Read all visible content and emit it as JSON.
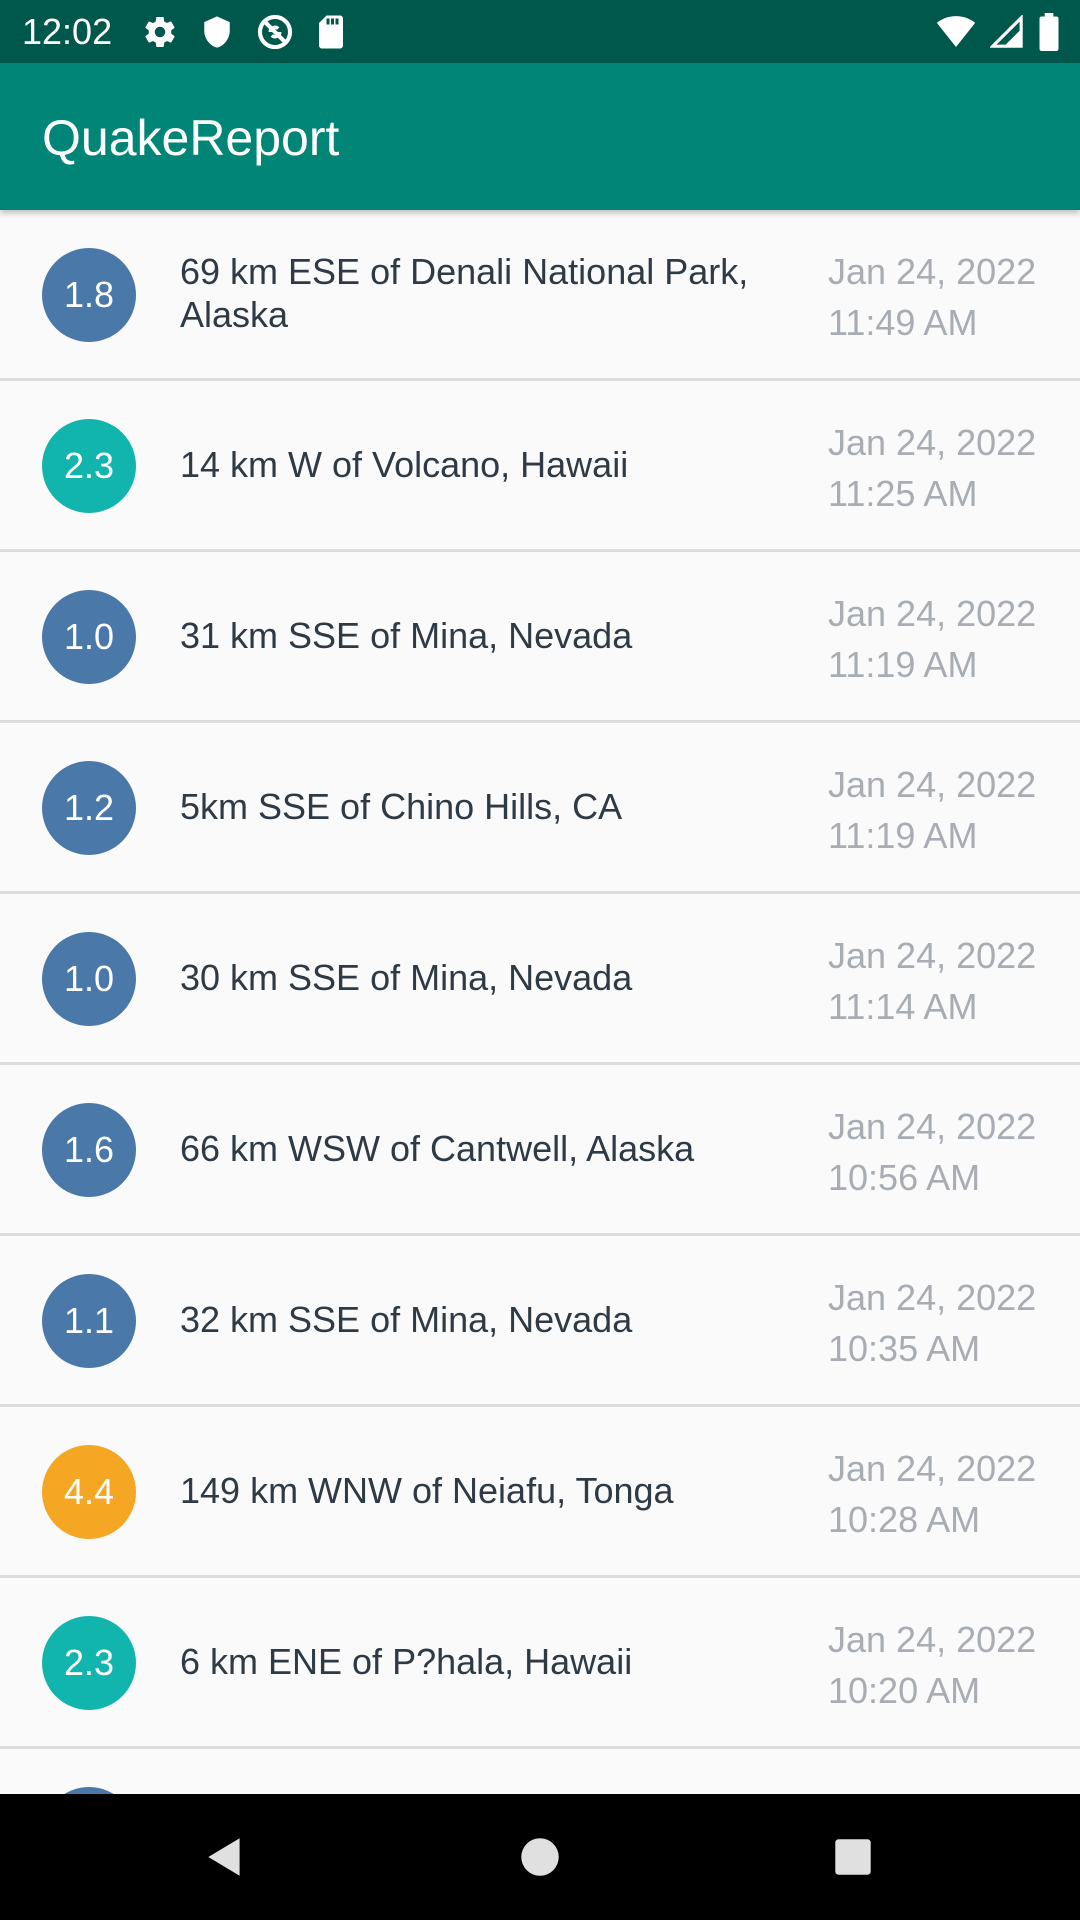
{
  "status_bar": {
    "time": "12:02",
    "left_icons": [
      "settings-icon",
      "shield-icon",
      "no-sync-icon",
      "sd-card-icon"
    ],
    "right_icons": [
      "wifi-icon",
      "signal-icon",
      "battery-icon"
    ]
  },
  "app_bar": {
    "title": "QuakeReport",
    "color": "#008577",
    "status_color": "#00574b"
  },
  "quakes": [
    {
      "magnitude": "1.8",
      "location_line1": "69 km ESE of Denali National Park,",
      "location_line2": "Alaska",
      "date": "Jan 24, 2022",
      "time": "11:49 AM",
      "color": "#4a78a8"
    },
    {
      "magnitude": "2.3",
      "location_line1": "14 km W of Volcano, Hawaii",
      "location_line2": "",
      "date": "Jan 24, 2022",
      "time": "11:25 AM",
      "color": "#12b5ad"
    },
    {
      "magnitude": "1.0",
      "location_line1": "31 km SSE of Mina, Nevada",
      "location_line2": "",
      "date": "Jan 24, 2022",
      "time": "11:19 AM",
      "color": "#4a78a8"
    },
    {
      "magnitude": "1.2",
      "location_line1": "5km SSE of Chino Hills, CA",
      "location_line2": "",
      "date": "Jan 24, 2022",
      "time": "11:19 AM",
      "color": "#4a78a8"
    },
    {
      "magnitude": "1.0",
      "location_line1": "30 km SSE of Mina, Nevada",
      "location_line2": "",
      "date": "Jan 24, 2022",
      "time": "11:14 AM",
      "color": "#4a78a8"
    },
    {
      "magnitude": "1.6",
      "location_line1": "66 km WSW of Cantwell, Alaska",
      "location_line2": "",
      "date": "Jan 24, 2022",
      "time": "10:56 AM",
      "color": "#4a78a8"
    },
    {
      "magnitude": "1.1",
      "location_line1": "32 km SSE of Mina, Nevada",
      "location_line2": "",
      "date": "Jan 24, 2022",
      "time": "10:35 AM",
      "color": "#4a78a8"
    },
    {
      "magnitude": "4.4",
      "location_line1": "149 km WNW of Neiafu, Tonga",
      "location_line2": "",
      "date": "Jan 24, 2022",
      "time": "10:28 AM",
      "color": "#f5a623"
    },
    {
      "magnitude": "2.3",
      "location_line1": "6 km ENE of P?hala, Hawaii",
      "location_line2": "",
      "date": "Jan 24, 2022",
      "time": "10:20 AM",
      "color": "#12b5ad"
    }
  ],
  "partial_next_item_color": "#4a78a8",
  "nav_bar": {
    "icons": [
      "back-icon",
      "home-icon",
      "recents-icon"
    ]
  }
}
